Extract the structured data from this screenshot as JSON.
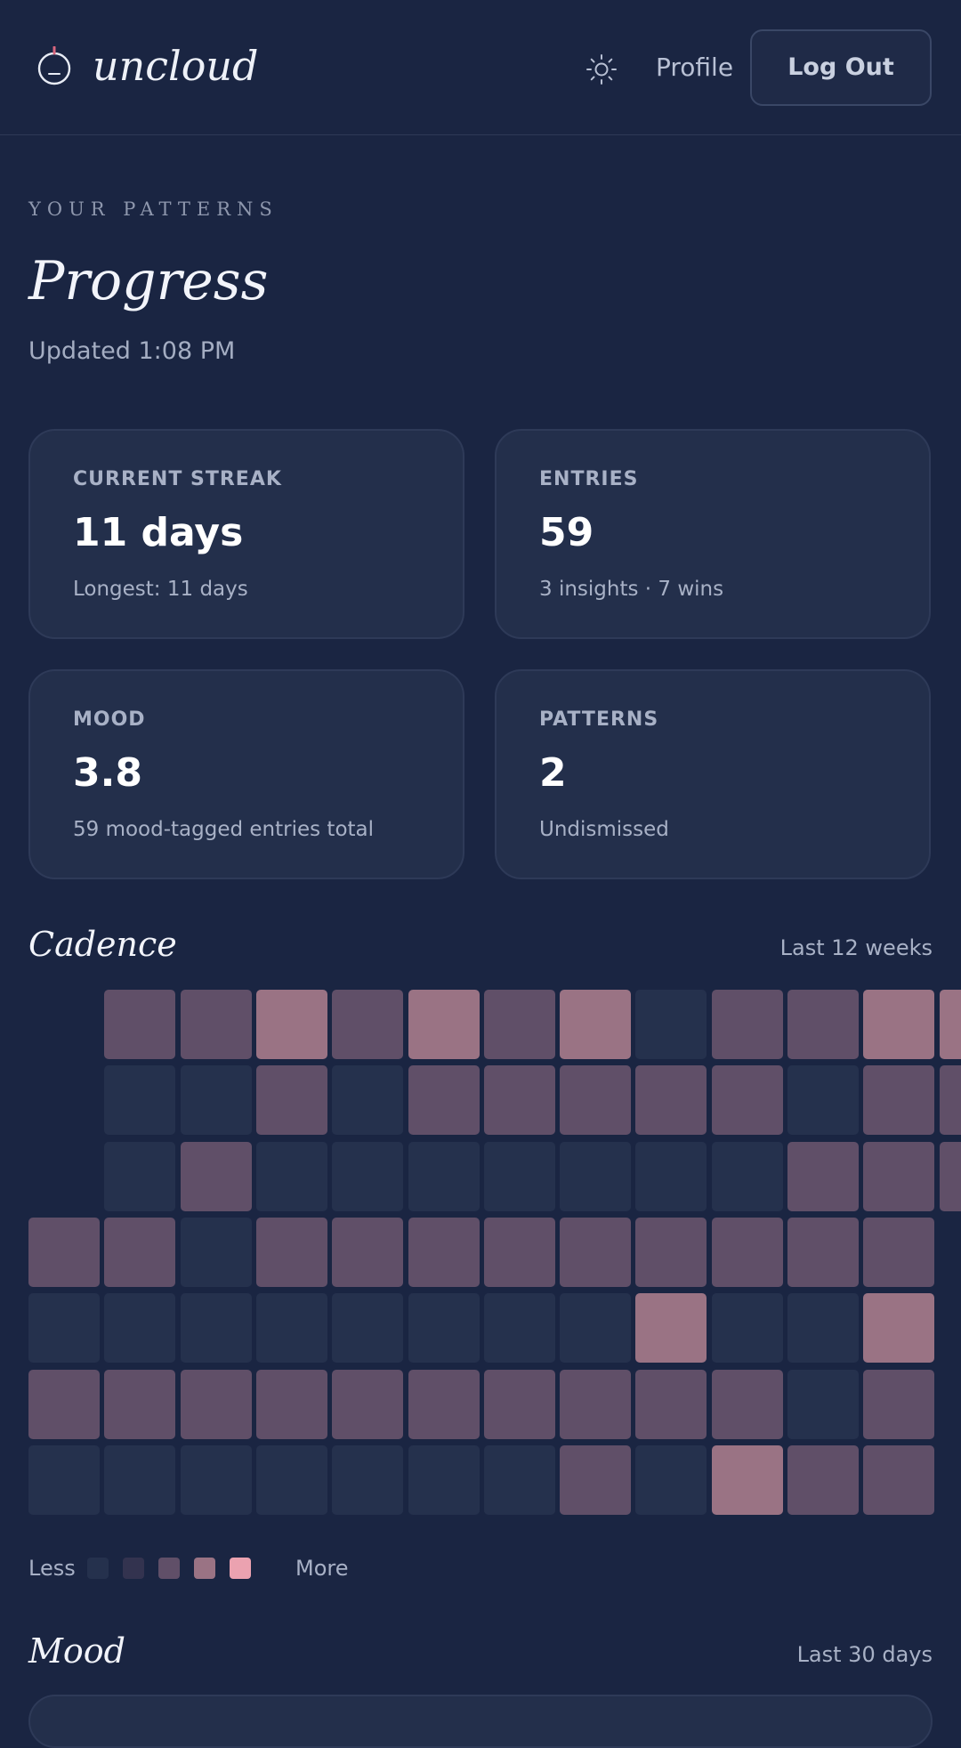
{
  "app": {
    "brand": "uncloud"
  },
  "nav": {
    "profile_label": "Profile",
    "logout_label": "Log Out"
  },
  "header": {
    "eyebrow": "YOUR PATTERNS",
    "title": "Progress",
    "updated": "Updated 1:08 PM"
  },
  "stats": [
    {
      "label": "CURRENT STREAK",
      "value": "11 days",
      "sub": "Longest: 11 days"
    },
    {
      "label": "ENTRIES",
      "value": "59",
      "sub": "3 insights · 7 wins"
    },
    {
      "label": "MOOD",
      "value": "3.8",
      "sub": "59 mood-tagged entries total"
    },
    {
      "label": "PATTERNS",
      "value": "2",
      "sub": "Undismissed"
    }
  ],
  "cadence": {
    "title": "Cadence",
    "range": "Last 12 weeks",
    "levels": [
      [
        -1,
        2,
        2,
        3,
        2,
        3,
        2,
        3,
        0,
        2,
        2,
        3,
        3
      ],
      [
        -1,
        0,
        0,
        2,
        0,
        2,
        2,
        2,
        2,
        2,
        0,
        2,
        2
      ],
      [
        -1,
        0,
        2,
        0,
        0,
        0,
        0,
        0,
        0,
        0,
        2,
        2,
        2
      ],
      [
        2,
        2,
        0,
        2,
        2,
        2,
        2,
        2,
        2,
        2,
        2,
        2,
        -1
      ],
      [
        0,
        0,
        0,
        0,
        0,
        0,
        0,
        0,
        3,
        0,
        0,
        3,
        -1
      ],
      [
        2,
        2,
        2,
        2,
        2,
        2,
        2,
        2,
        2,
        2,
        0,
        2,
        -1
      ],
      [
        0,
        0,
        0,
        0,
        0,
        0,
        0,
        2,
        0,
        3,
        2,
        2,
        -1
      ]
    ],
    "level_colors": [
      "#25314d",
      "#33334f",
      "#604f68",
      "#9a7384",
      "#eba2b0"
    ],
    "legend_less": "Less",
    "legend_more": "More"
  },
  "mood": {
    "title": "Mood",
    "range": "Last 30 days"
  },
  "colors": {
    "background": "#1a2542",
    "card": "#232f4b",
    "accent": "#eba2b0"
  }
}
